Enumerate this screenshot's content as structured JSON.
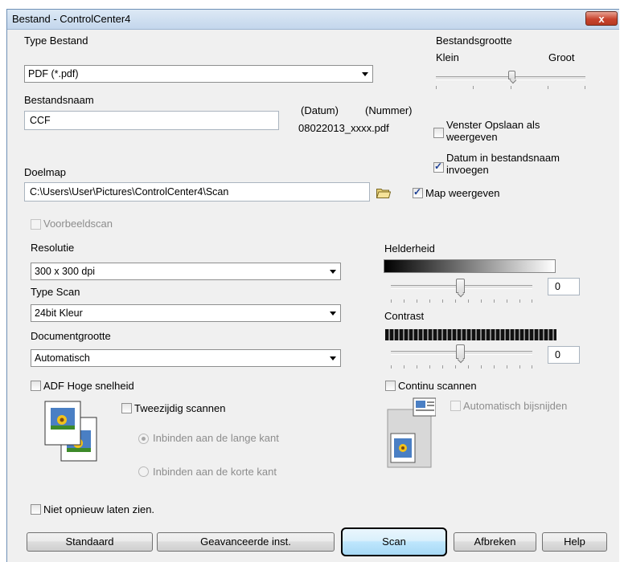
{
  "window": {
    "title": "Bestand - ControlCenter4",
    "close_label": "x"
  },
  "file_type": {
    "label": "Type Bestand",
    "value": "PDF (*.pdf)"
  },
  "file_size": {
    "label": "Bestandsgrootte",
    "min_label": "Klein",
    "max_label": "Groot",
    "level": 0.5
  },
  "file_name": {
    "label": "Bestandsnaam",
    "value": "CCF",
    "date_label": "(Datum)",
    "number_label": "(Nummer)",
    "example": "08022013_xxxx.pdf"
  },
  "options": {
    "save_as_window": {
      "label_line1": "Venster Opslaan als",
      "label_line2": "weergeven",
      "checked": false
    },
    "date_in_name": {
      "label_line1": "Datum in bestandsnaam",
      "label_line2": "invoegen",
      "checked": true
    },
    "show_folder": {
      "label": "Map weergeven",
      "checked": true
    }
  },
  "destination": {
    "label": "Doelmap",
    "value": "C:\\Users\\User\\Pictures\\ControlCenter4\\Scan",
    "browse_icon": "folder-icon"
  },
  "preview_scan": {
    "label": "Voorbeeldscan",
    "checked": false,
    "enabled": false
  },
  "resolution": {
    "label": "Resolutie",
    "value": "300 x 300 dpi"
  },
  "scan_type": {
    "label": "Type Scan",
    "value": "24bit Kleur"
  },
  "document_size": {
    "label": "Documentgrootte",
    "value": "Automatisch"
  },
  "brightness": {
    "label": "Helderheid",
    "value": "0",
    "level": 0.5
  },
  "contrast": {
    "label": "Contrast",
    "value": "0",
    "level": 0.5
  },
  "adf_high_speed": {
    "label": "ADF Hoge snelheid",
    "checked": false
  },
  "duplex": {
    "label": "Tweezijdig scannen",
    "checked": false,
    "long_edge": "Inbinden aan de lange kant",
    "short_edge": "Inbinden aan de korte kant",
    "selected": "long_edge",
    "icon": "duplex-pages-icon"
  },
  "continuous_scan": {
    "label": "Continu scannen",
    "checked": false
  },
  "auto_crop": {
    "label": "Automatisch bijsnijden",
    "checked": false,
    "enabled": false,
    "icon": "auto-crop-icon"
  },
  "dont_show_again": {
    "label": "Niet opnieuw laten zien.",
    "checked": false
  },
  "buttons": {
    "default_label": "Standaard",
    "advanced_label": "Geavanceerde inst.",
    "scan_label": "Scan",
    "cancel_label": "Afbreken",
    "help_label": "Help"
  },
  "colors": {
    "title_bar": "#c3d6ec",
    "close_button": "#c8442e",
    "scan_button": "#bee6fd",
    "dialog_bg": "#f0f0f0"
  }
}
